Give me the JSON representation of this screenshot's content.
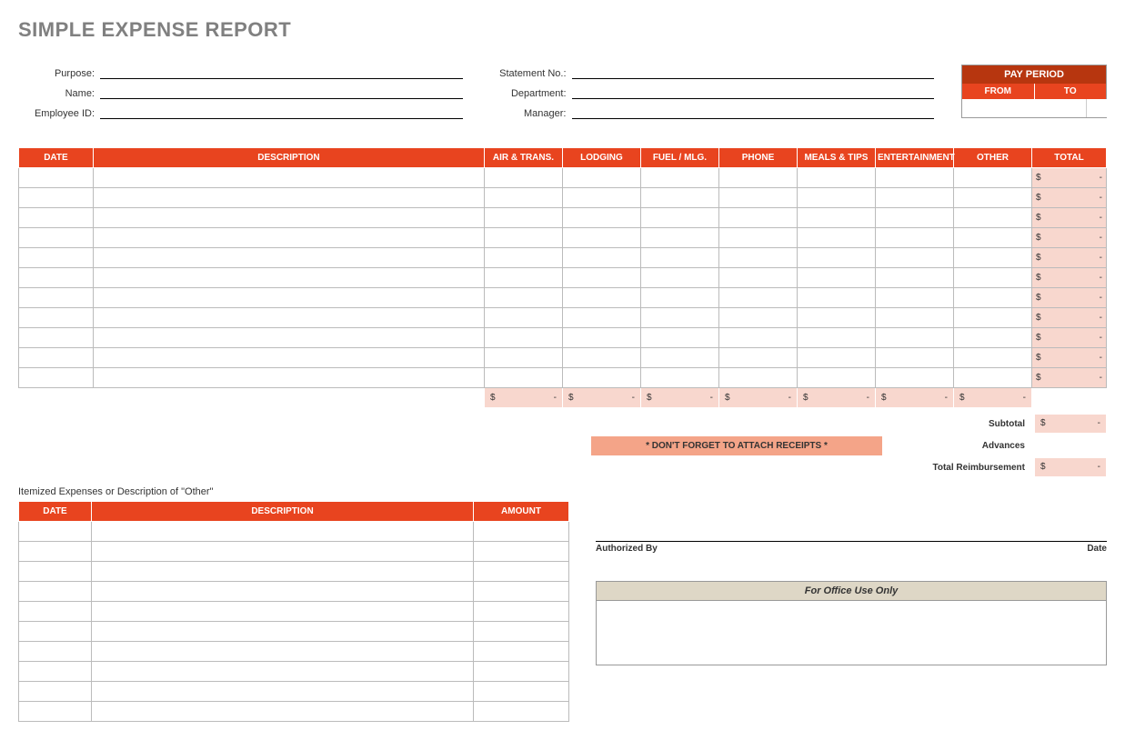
{
  "title": "SIMPLE EXPENSE REPORT",
  "fields_left": [
    {
      "label": "Purpose:",
      "value": ""
    },
    {
      "label": "Name:",
      "value": ""
    },
    {
      "label": "Employee ID:",
      "value": ""
    }
  ],
  "fields_right": [
    {
      "label": "Statement No.:",
      "value": ""
    },
    {
      "label": "Department:",
      "value": ""
    },
    {
      "label": "Manager:",
      "value": ""
    }
  ],
  "pay_period": {
    "header": "PAY PERIOD",
    "from_label": "FROM",
    "to_label": "TO",
    "from_value": "",
    "to_value": ""
  },
  "main_headers": [
    "DATE",
    "DESCRIPTION",
    "AIR & TRANS.",
    "LODGING",
    "FUEL / MLG.",
    "PHONE",
    "MEALS & TIPS",
    "ENTERTAINMENT",
    "OTHER",
    "TOTAL"
  ],
  "main_rows": 11,
  "currency": "$",
  "dash": "-",
  "reminder": "* DON'T FORGET TO ATTACH RECEIPTS *",
  "summary": {
    "subtotal_label": "Subtotal",
    "advances_label": "Advances",
    "total_reimb_label": "Total Reimbursement"
  },
  "itemized_title": "Itemized Expenses or Description of \"Other\"",
  "itemized_headers": [
    "DATE",
    "DESCRIPTION",
    "AMOUNT"
  ],
  "itemized_rows": 10,
  "sign": {
    "auth_label": "Authorized By",
    "date_label": "Date"
  },
  "office_use": "For Office Use Only"
}
